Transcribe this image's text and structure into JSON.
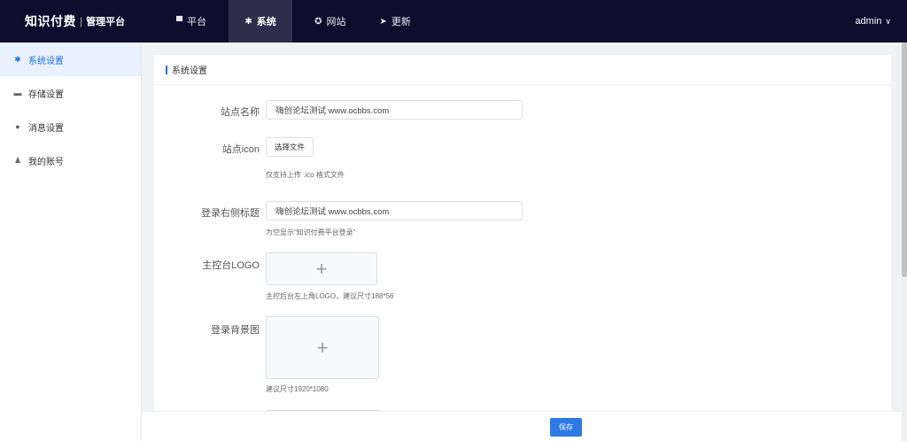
{
  "brand": {
    "main": "知识付费",
    "separator": "|",
    "sub": "管理平台"
  },
  "nav": [
    {
      "icon": "monitor-icon",
      "glyph": "▀",
      "label": "平台"
    },
    {
      "icon": "gear-icon",
      "glyph": "✱",
      "label": "系统",
      "active": true
    },
    {
      "icon": "circle-icon",
      "glyph": "✪",
      "label": "网站"
    },
    {
      "icon": "send-icon",
      "glyph": "➤",
      "label": "更新"
    }
  ],
  "user": {
    "name": "admin",
    "chevron": "∨"
  },
  "sidebar": [
    {
      "icon": "gear-icon",
      "glyph": "✱",
      "label": "系统设置",
      "active": true
    },
    {
      "icon": "folder-icon",
      "glyph": "▬",
      "label": "存储设置"
    },
    {
      "icon": "chat-icon",
      "glyph": "●",
      "label": "消息设置"
    },
    {
      "icon": "user-icon",
      "glyph": "♟",
      "label": "我的账号"
    }
  ],
  "card": {
    "title": "系统设置"
  },
  "form": {
    "site_name": {
      "label": "站点名称",
      "value": "嗨创论坛测试 www.ocbbs.com"
    },
    "site_icon": {
      "label": "站点icon",
      "button": "选择文件",
      "hint": "仅支持上传 .ico 格式文件"
    },
    "login_title": {
      "label": "登录右侧标题",
      "value": "嗨创论坛测试 www.ocbbs.com",
      "hint": "为空显示“知识付费平台登录”"
    },
    "console_logo": {
      "label": "主控台LOGO",
      "plus": "+",
      "hint": "主控后台左上角LOGO，建议尺寸188*56"
    },
    "login_bg": {
      "label": "登录背景图",
      "plus": "+",
      "hint": "建议尺寸1920*1080"
    }
  },
  "footer": {
    "save": "保存"
  },
  "colors": {
    "topbar": "#0f0d2e",
    "accent": "#2b7ae6",
    "active_nav": "#2f2d4a"
  }
}
